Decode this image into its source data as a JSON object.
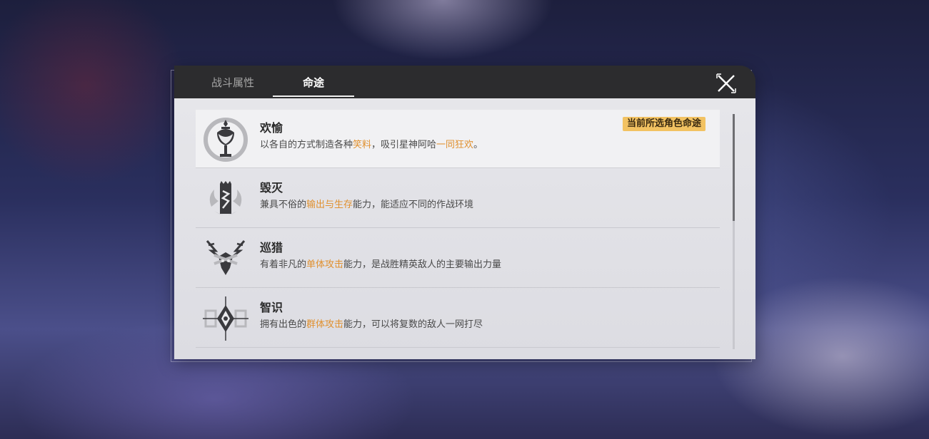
{
  "tabs": [
    {
      "label": "战斗属性",
      "active": false
    },
    {
      "label": "命途",
      "active": true
    }
  ],
  "close_icon": "close-x-icon",
  "current_badge": "当前所选角色命途",
  "paths": [
    {
      "name": "欢愉",
      "icon": "elation-path-icon",
      "selected": true,
      "desc": [
        {
          "t": "以各自的方式制造各种",
          "hl": false
        },
        {
          "t": "笑料",
          "hl": true
        },
        {
          "t": "，吸引星神阿哈",
          "hl": false
        },
        {
          "t": "一同狂欢",
          "hl": true
        },
        {
          "t": "。",
          "hl": false
        }
      ]
    },
    {
      "name": "毁灭",
      "icon": "destruction-path-icon",
      "selected": false,
      "desc": [
        {
          "t": "兼具不俗的",
          "hl": false
        },
        {
          "t": "输出与生存",
          "hl": true
        },
        {
          "t": "能力，能适应不同的作战环境",
          "hl": false
        }
      ]
    },
    {
      "name": "巡猎",
      "icon": "hunt-path-icon",
      "selected": false,
      "desc": [
        {
          "t": "有着非凡的",
          "hl": false
        },
        {
          "t": "单体攻击",
          "hl": true
        },
        {
          "t": "能力，是战胜精英敌人的主要输出力量",
          "hl": false
        }
      ]
    },
    {
      "name": "智识",
      "icon": "erudition-path-icon",
      "selected": false,
      "desc": [
        {
          "t": "拥有出色的",
          "hl": false
        },
        {
          "t": "群体攻击",
          "hl": true
        },
        {
          "t": "能力，可以将复数的敌人一网打尽",
          "hl": false
        }
      ]
    }
  ],
  "colors": {
    "header_bg": "#2c2c2e",
    "highlight": "#e0902e",
    "badge_bg": "#f2c262"
  }
}
